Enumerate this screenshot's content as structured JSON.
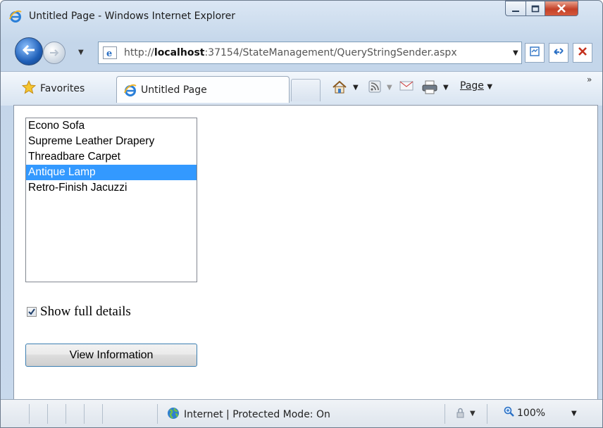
{
  "window": {
    "title": "Untitled Page - Windows Internet Explorer"
  },
  "address_bar": {
    "url_prefix": "http://",
    "url_host": "localhost",
    "url_rest": ":37154/StateManagement/QueryStringSender.aspx"
  },
  "favorites_bar": {
    "favorites_label": "Favorites",
    "tab_label": "Untitled Page",
    "page_menu_label": "Page"
  },
  "page": {
    "list_items": [
      "Econo Sofa",
      "Supreme Leather Drapery",
      "Threadbare Carpet",
      "Antique Lamp",
      "Retro-Finish Jacuzzi"
    ],
    "selected_item": "Antique Lamp",
    "checkbox_label": "Show full details",
    "checkbox_checked": true,
    "button_label": "View Information"
  },
  "status_bar": {
    "zone_text": "Internet | Protected Mode: On",
    "zoom": "100%"
  },
  "colors": {
    "selection": "#3399ff",
    "close_button": "#c44128",
    "chrome": "#c8d9ec"
  }
}
